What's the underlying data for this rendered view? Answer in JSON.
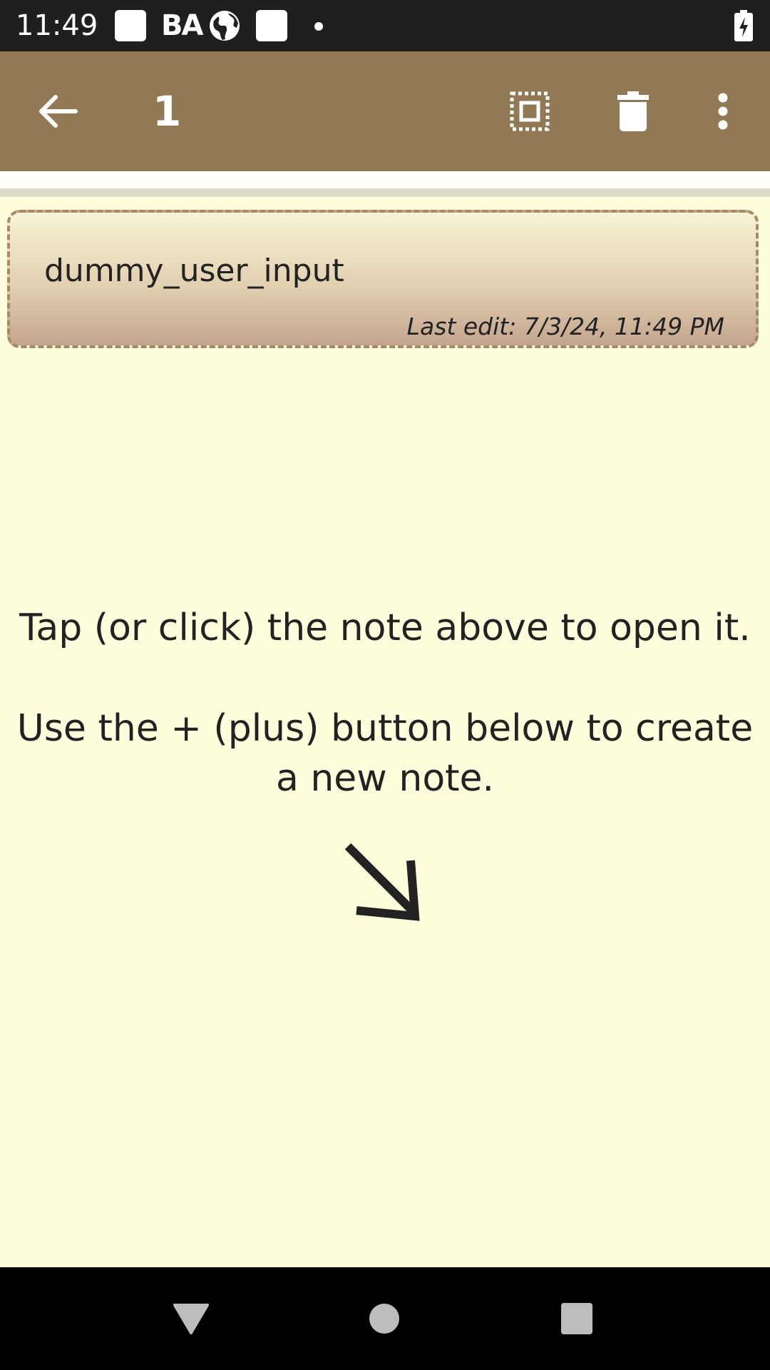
{
  "status_bar": {
    "time": "11:49",
    "notification_text": "BA",
    "icons": [
      "square-notification-icon",
      "globe-icon",
      "square-notification-icon",
      "dot-icon",
      "battery-charging-icon"
    ]
  },
  "app_bar": {
    "title": "1",
    "icons": [
      "back-arrow-icon",
      "select-all-icon",
      "delete-icon",
      "more-vert-icon"
    ],
    "background_color": "#927956"
  },
  "note": {
    "title": "dummy_user_input",
    "last_edit": "Last edit: 7/3/24, 11:49 PM"
  },
  "hints": {
    "open_note": "Tap (or click) the note above to open it.",
    "create_note": "Use the + (plus) button below to create a new note."
  },
  "nav_bar": {
    "icons": [
      "back-triangle-icon",
      "home-circle-icon",
      "recents-square-icon"
    ]
  },
  "colors": {
    "page_background": "#fefedd",
    "card_border": "#a88a62",
    "text": "#222222"
  }
}
